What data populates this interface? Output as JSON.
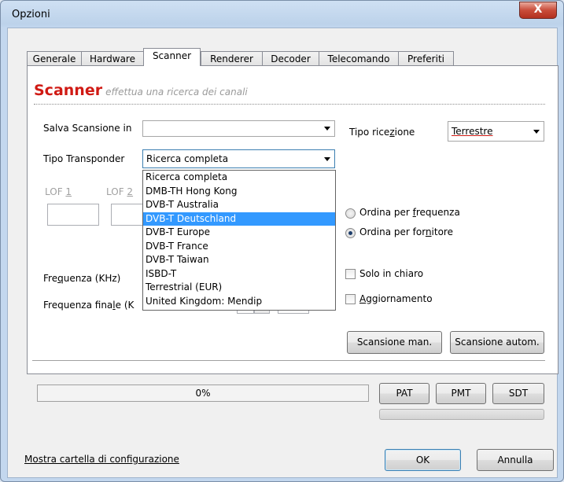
{
  "window": {
    "title": "Opzioni",
    "close_label": "X"
  },
  "tabs": [
    {
      "label": "Generale"
    },
    {
      "label": "Hardware"
    },
    {
      "label": "Scanner"
    },
    {
      "label": "Renderer"
    },
    {
      "label": "Decoder"
    },
    {
      "label": "Telecomando"
    },
    {
      "label": "Preferiti"
    }
  ],
  "scanner": {
    "title": "Scanner",
    "subtitle": "effettua una ricerca dei canali",
    "save_scan_label": "Salva Scansione in",
    "save_scan_value": "",
    "reception_label_pre": "Tipo rice",
    "reception_label_acc": "z",
    "reception_label_post": "ione",
    "reception_value": "Terrestre",
    "transponder_label": "Tipo Transponder",
    "transponder_value": "Ricerca completa",
    "transponder_options": [
      "Ricerca completa",
      "DMB-TH Hong Kong",
      "DVB-T Australia",
      "DVB-T Deutschland",
      "DVB-T Europe",
      "DVB-T France",
      "DVB-T Taiwan",
      "ISBD-T",
      "Terrestrial (EUR)",
      "United Kingdom: Mendip"
    ],
    "lof1_pre": "LOF ",
    "lof1_acc": "1",
    "lof2_pre": "LOF ",
    "lof2_acc": "2",
    "sort_freq_pre": "Ordina per ",
    "sort_freq_acc": "f",
    "sort_freq_post": "requenza",
    "sort_prov_pre": "Ordina per for",
    "sort_prov_acc": "n",
    "sort_prov_post": "itore",
    "freq_pre": "Fre",
    "freq_acc": "q",
    "freq_post": "uenza (KHz)",
    "freq_final_pre": "Frequenza fina",
    "freq_final_acc": "l",
    "freq_final_post": "e (K",
    "only_free_label": "Solo in chiaro",
    "update_acc": "A",
    "update_post": "ggiornamento",
    "manual_scan": "Scansione man.",
    "auto_scan": "Scansione autom."
  },
  "progress": {
    "text": "0%",
    "value": 0
  },
  "tables": {
    "pat": "PAT",
    "pmt": "PMT",
    "sdt": "SDT"
  },
  "footer": {
    "config_link": "Mostra cartella di configurazione",
    "ok": "OK",
    "cancel": "Annulla"
  }
}
